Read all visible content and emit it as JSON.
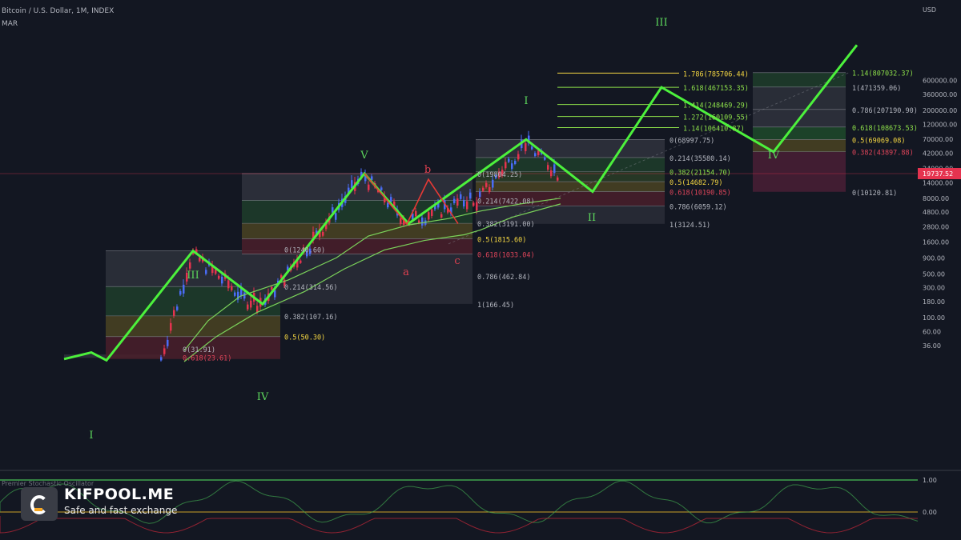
{
  "header": {
    "title": "Bitcoin / U.S. Dollar, 1M, INDEX",
    "indicator": "MAR",
    "oscillator_label": "Premier Stochastic Oscillator"
  },
  "brand": {
    "name": "KIFPOOL.ME",
    "tagline": "Safe and fast exchange"
  },
  "colors": {
    "background": "#131722",
    "wave_green": "#4cf13c",
    "correction_red": "#e53935",
    "fib_yellow": "#f5d742",
    "fib_green_text": "#8de04a",
    "fib_red_text": "#e0455a",
    "price_tag": "#e5334f"
  },
  "chart_data": {
    "type": "line",
    "y_scale": "log",
    "currency": "USD",
    "current_price": "19737.52",
    "y_ticks": [
      "600000.00",
      "360000.00",
      "200000.00",
      "120000.00",
      "70000.00",
      "42000.00",
      "24000.00",
      "14000.00",
      "8000.00",
      "4800.00",
      "2800.00",
      "1600.00",
      "900.00",
      "500.00",
      "300.00",
      "180.00",
      "100.00",
      "60.00",
      "36.00"
    ],
    "osc_ticks": [
      "1.00",
      "0.00"
    ],
    "wave_labels": [
      {
        "text": "I",
        "color": "green",
        "price": 28,
        "idx": 0
      },
      {
        "text": "III",
        "color": "green",
        "price": 1163,
        "idx": 1
      },
      {
        "text": "IV",
        "color": "green",
        "price": 165,
        "idx": 2
      },
      {
        "text": "V",
        "color": "green",
        "price": 19783,
        "idx": 3
      },
      {
        "text": "b",
        "color": "red",
        "price": 16000,
        "idx": 4
      },
      {
        "text": "a",
        "color": "red",
        "price": 3100,
        "idx": 5
      },
      {
        "text": "c",
        "color": "red",
        "price": 3150,
        "idx": 6
      },
      {
        "text": "I",
        "color": "green",
        "price": 68997,
        "idx": 7
      },
      {
        "text": "II",
        "color": "green",
        "price": 10190,
        "idx": 8
      },
      {
        "text": "III",
        "color": "green",
        "price": 467153,
        "idx": 9
      },
      {
        "text": "IV",
        "color": "green",
        "price": 43897,
        "idx": 10
      }
    ],
    "fib_sets": [
      {
        "name": "set1",
        "levels": [
          {
            "text": "0(31.91)",
            "price": 31.91,
            "color": "gray"
          },
          {
            "text": "0.618(23.61)",
            "price": 23.61,
            "color": "red"
          }
        ]
      },
      {
        "name": "set2",
        "levels": [
          {
            "text": "0(1240.60)",
            "price": 1240.6,
            "color": "gray"
          },
          {
            "text": "0.214(314.56)",
            "price": 314.56,
            "color": "gray"
          },
          {
            "text": "0.382(107.16)",
            "price": 107.16,
            "color": "gray"
          },
          {
            "text": "0.5(50.30)",
            "price": 50.3,
            "color": "yellow"
          }
        ]
      },
      {
        "name": "set3",
        "levels": [
          {
            "text": "0.5(1815.60)",
            "price": 1815.6,
            "color": "yellow"
          },
          {
            "text": "0.618(1033.04)",
            "price": 1033.04,
            "color": "red"
          },
          {
            "text": "0.786(462.84)",
            "price": 462.84,
            "color": "gray"
          },
          {
            "text": "1(166.45)",
            "price": 166.45,
            "color": "gray"
          }
        ]
      },
      {
        "name": "set4",
        "levels": [
          {
            "text": "0(19804.25)",
            "price": 19804.25,
            "color": "gray"
          },
          {
            "text": "0.214(7422.08)",
            "price": 7422.08,
            "color": "gray"
          },
          {
            "text": "0.382(3191.00)",
            "price": 3191,
            "color": "gray"
          }
        ]
      },
      {
        "name": "set5",
        "levels": [
          {
            "text": "0(68997.75)",
            "price": 68997.75,
            "color": "gray"
          },
          {
            "text": "0.214(35580.14)",
            "price": 35580.14,
            "color": "gray"
          },
          {
            "text": "0.382(21154.70)",
            "price": 21154.7,
            "color": "green"
          },
          {
            "text": "0.5(14682.79)",
            "price": 14682.79,
            "color": "yellow"
          },
          {
            "text": "0.618(10190.85)",
            "price": 10190.85,
            "color": "red"
          },
          {
            "text": "0.786(6059.12)",
            "price": 6059.12,
            "color": "gray"
          },
          {
            "text": "1(3124.51)",
            "price": 3124.51,
            "color": "gray"
          }
        ]
      },
      {
        "name": "set6",
        "levels": [
          {
            "text": "1.786(785706.44)",
            "price": 785706.44,
            "color": "yellow"
          },
          {
            "text": "1.618(467153.35)",
            "price": 467153.35,
            "color": "green"
          },
          {
            "text": "1.414(248469.29)",
            "price": 248469.29,
            "color": "green"
          },
          {
            "text": "1.272(160109.55)",
            "price": 160109.55,
            "color": "green"
          },
          {
            "text": "1.14(106410.87)",
            "price": 106410.87,
            "color": "green"
          }
        ]
      },
      {
        "name": "set7",
        "levels": [
          {
            "text": "1.14(807032.37)",
            "price": 807032.37,
            "color": "green"
          },
          {
            "text": "1(471359.06)",
            "price": 471359.06,
            "color": "gray"
          },
          {
            "text": "0.786(207190.90)",
            "price": 207190.9,
            "color": "gray"
          },
          {
            "text": "0.618(108673.53)",
            "price": 108673.53,
            "color": "green"
          },
          {
            "text": "0.5(69069.08)",
            "price": 69069.08,
            "color": "yellow"
          },
          {
            "text": "0.382(43897.88)",
            "price": 43897.88,
            "color": "red"
          },
          {
            "text": "0(10120.81)",
            "price": 10120.81,
            "color": "gray"
          }
        ]
      }
    ],
    "wave_path_prices": [
      22,
      28,
      21,
      1163,
      165,
      19783,
      3150,
      68997,
      10190,
      467153,
      43897,
      2200000
    ],
    "correction_path_prices": [
      19783,
      3100,
      16000,
      3150
    ]
  }
}
